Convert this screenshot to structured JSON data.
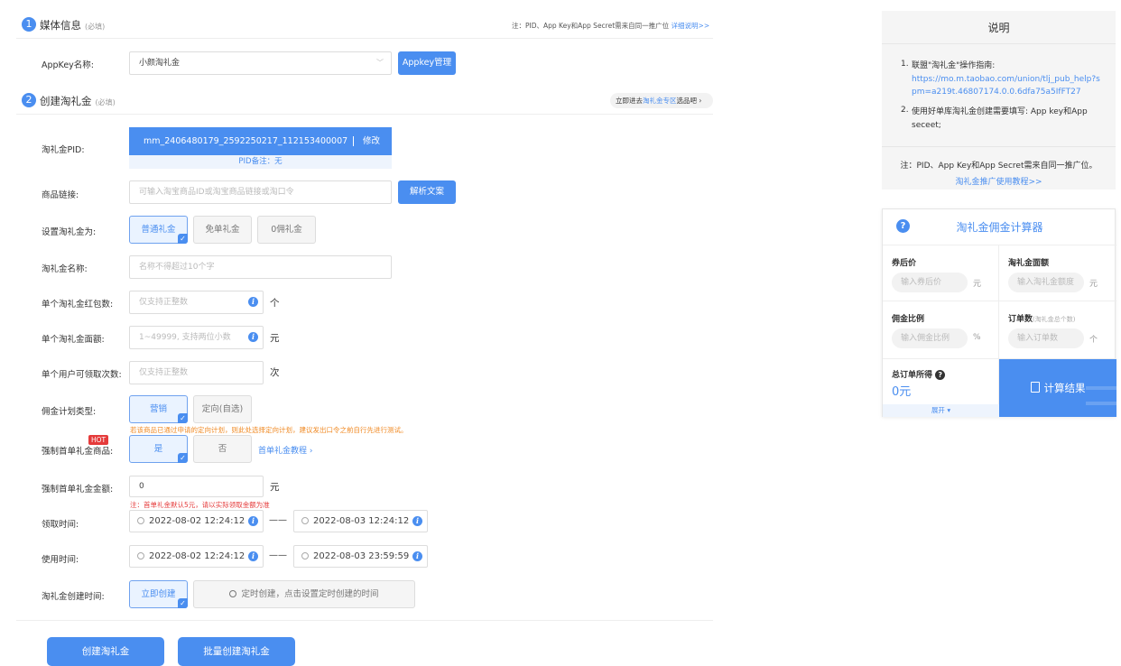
{
  "section1": {
    "number": "1",
    "title": "媒体信息",
    "required": "(必填)",
    "note": "注：PID、App Key和App Secret需来自同一推广位",
    "note_link": "详细说明>>"
  },
  "appkey": {
    "label": "AppKey名称:",
    "value": "小颜淘礼金",
    "manage_button": "Appkey管理"
  },
  "section2": {
    "number": "2",
    "title": "创建淘礼金",
    "required": "(必填)",
    "promo_prefix": "立即进去",
    "promo_link": "淘礼金专区",
    "promo_suffix": "选品吧"
  },
  "pid": {
    "label": "淘礼金PID:",
    "value": "mm_2406480179_2592250217_112153400007",
    "edit": "修改",
    "remark": "PID备注：无"
  },
  "product_link": {
    "label": "商品链接:",
    "placeholder": "可输入淘宝商品ID或淘宝商品链接或淘口令",
    "parse_button": "解析文案"
  },
  "set_type": {
    "label": "设置淘礼金为:",
    "options": [
      "普通礼金",
      "免单礼金",
      "0佣礼金"
    ]
  },
  "name": {
    "label": "淘礼金名称:",
    "placeholder": "名称不得超过10个字"
  },
  "packet_count": {
    "label": "单个淘礼金红包数:",
    "placeholder": "仅支持正整数",
    "unit": "个"
  },
  "amount": {
    "label": "单个淘礼金面额:",
    "placeholder": "1~49999, 支持两位小数",
    "unit": "元"
  },
  "user_limit": {
    "label": "单个用户可领取次数:",
    "placeholder": "仅支持正整数",
    "unit": "次"
  },
  "plan_type": {
    "label": "佣金计划类型:",
    "options": [
      "营销",
      "定向(自选)"
    ],
    "warning": "若该商品已通过申请的定向计划，则此处选择定向计划，建议发出口令之前自行先进行测试。"
  },
  "first_order": {
    "label": "强制首单礼金商品:",
    "hot": "HOT",
    "options": [
      "是",
      "否"
    ],
    "tutorial": "首单礼金教程"
  },
  "first_amount": {
    "label": "强制首单礼金金额:",
    "value": "0",
    "unit": "元",
    "note": "注：首单礼金默认5元，请以实际领取金额为准"
  },
  "receive_time": {
    "label": "领取时间:",
    "start": "2022-08-02 12:24:12",
    "end": "2022-08-03 12:24:12",
    "sep": "——"
  },
  "use_time": {
    "label": "使用时间:",
    "start": "2022-08-02 12:24:12",
    "end": "2022-08-03 23:59:59",
    "sep": "——"
  },
  "create_time": {
    "label": "淘礼金创建时间:",
    "immediate": "立即创建",
    "scheduled": "定时创建，点击设置定时创建的时间"
  },
  "actions": {
    "create": "创建淘礼金",
    "batch": "批量创建淘礼金"
  },
  "help": {
    "title": "说明",
    "item1_text": "联盟\"淘礼金\"操作指南:",
    "item1_link": "https://mo.m.taobao.com/union/tlj_pub_help?spm=a219t.46807174.0.0.6dfa75a5IfFT27",
    "item2_text": "使用好单库淘礼金创建需要填写: App key和App seceet;",
    "note": "注：PID、App Key和App Secret需来自同一推广位。",
    "tutorial_link": "淘礼金推广使用教程>>"
  },
  "calculator": {
    "title": "淘礼金佣金计算器",
    "after_coupon": {
      "label": "券后价",
      "placeholder": "输入券后价",
      "unit": "元"
    },
    "gift_amount": {
      "label": "淘礼金面额",
      "placeholder": "输入淘礼金额度",
      "unit": "元"
    },
    "commission_rate": {
      "label": "佣金比例",
      "placeholder": "输入佣金比例",
      "unit": "%"
    },
    "order_count": {
      "label": "订单数",
      "hint": "(淘礼金总个数)",
      "placeholder": "输入订单数",
      "unit": "个"
    },
    "total": {
      "label": "总订单所得",
      "value": "0元"
    },
    "expand": "展开",
    "button": "计算结果"
  },
  "colors": {
    "primary": "#4a8ef0",
    "warning": "#f08a24",
    "error": "#e53b3b",
    "hot": "#e53b3b"
  }
}
